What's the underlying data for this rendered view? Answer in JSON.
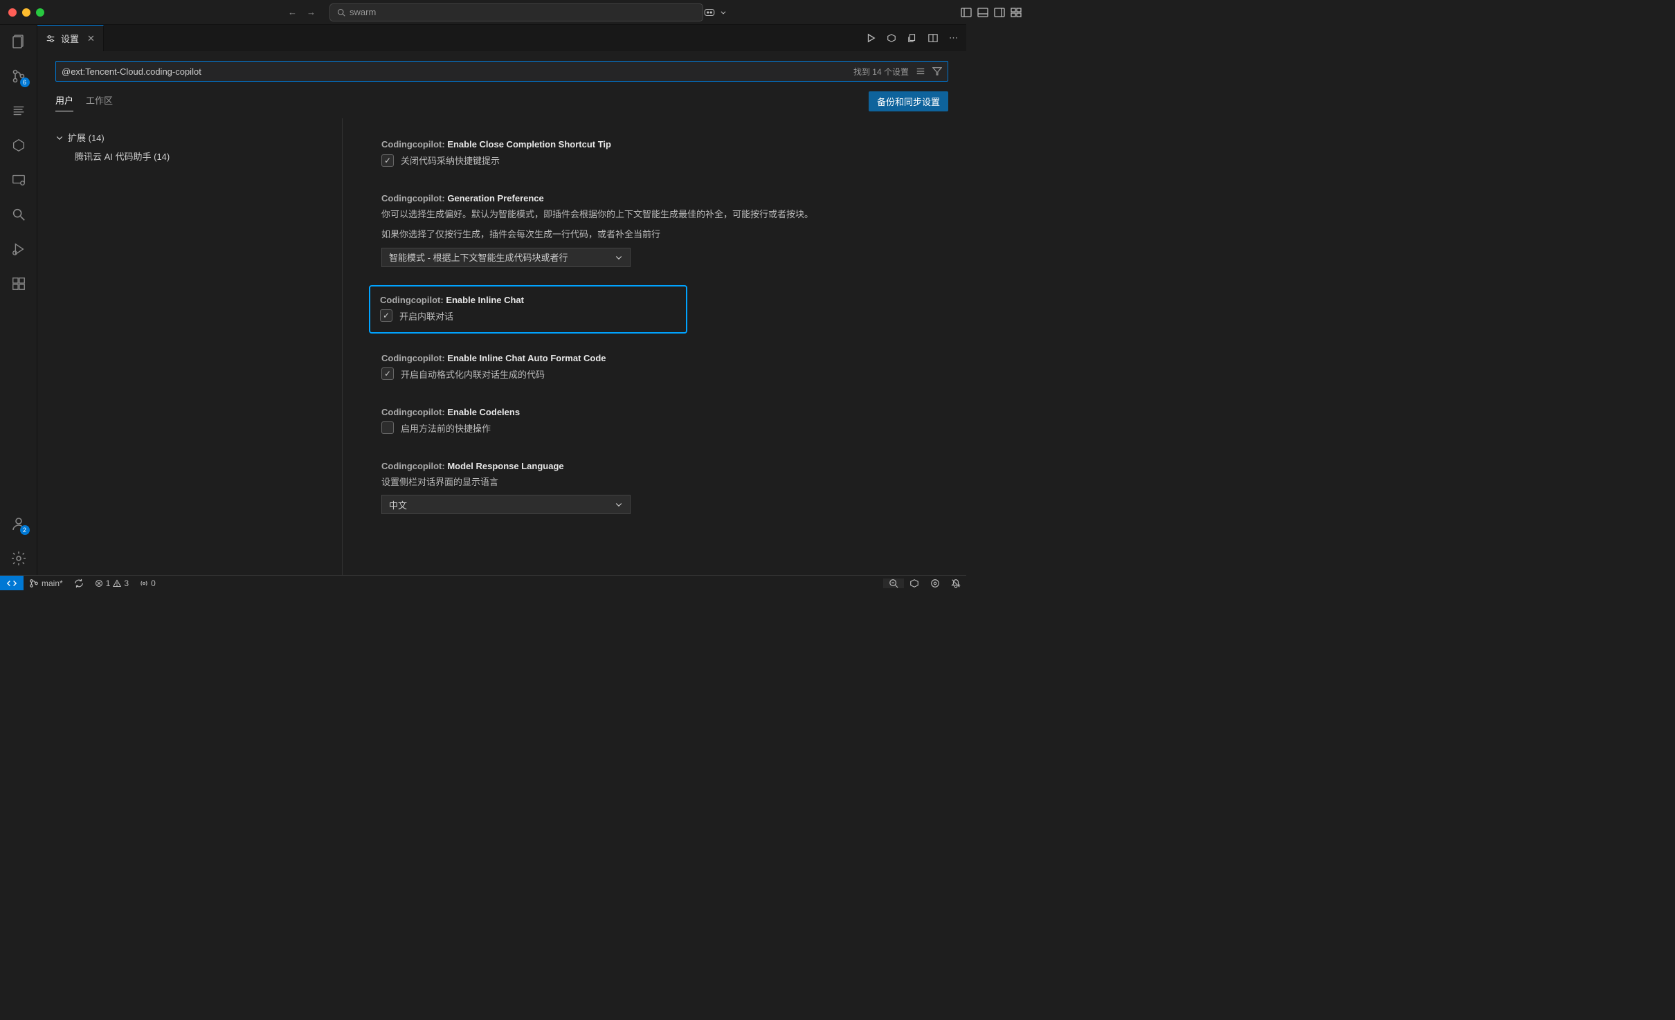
{
  "titlebar": {
    "search_placeholder": "swarm"
  },
  "activity": {
    "scm_badge": "6",
    "accounts_badge": "2"
  },
  "tab": {
    "label": "设置"
  },
  "search": {
    "value": "@ext:Tencent-Cloud.coding-copilot",
    "result_count": "找到 14 个设置"
  },
  "scope": {
    "user": "用户",
    "workspace": "工作区",
    "sync_button": "备份和同步设置"
  },
  "tree": {
    "extensions_label": "扩展 (14)",
    "item1": "腾讯云 AI 代码助手 (14)"
  },
  "settings": {
    "s1": {
      "prefix": "Codingcopilot: ",
      "title": "Enable Close Completion Shortcut Tip",
      "label": "关闭代码采纳快捷键提示"
    },
    "s2": {
      "prefix": "Codingcopilot: ",
      "title": "Generation Preference",
      "desc1": "你可以选择生成偏好。默认为智能模式，即插件会根据你的上下文智能生成最佳的补全，可能按行或者按块。",
      "desc2": "如果你选择了仅按行生成，插件会每次生成一行代码，或者补全当前行",
      "select": "智能模式 - 根据上下文智能生成代码块或者行"
    },
    "s3": {
      "prefix": "Codingcopilot: ",
      "title": "Enable Inline Chat",
      "label": "开启内联对话"
    },
    "s4": {
      "prefix": "Codingcopilot: ",
      "title": "Enable Inline Chat Auto Format Code",
      "label": "开启自动格式化内联对话生成的代码"
    },
    "s5": {
      "prefix": "Codingcopilot: ",
      "title": "Enable Codelens",
      "label": "启用方法前的快捷操作"
    },
    "s6": {
      "prefix": "Codingcopilot: ",
      "title": "Model Response Language",
      "desc": "设置侧栏对话界面的显示语言",
      "select": "中文"
    }
  },
  "statusbar": {
    "branch": "main*",
    "errors": "1",
    "warnings": "3",
    "ports": "0"
  }
}
